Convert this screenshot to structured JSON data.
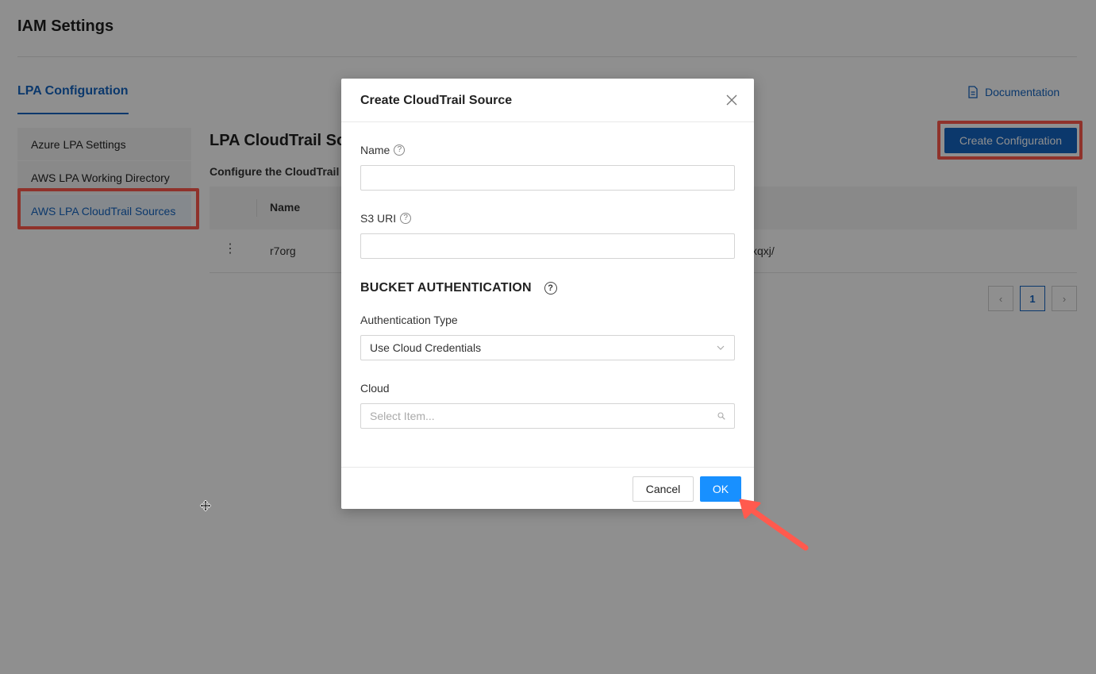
{
  "page": {
    "title": "IAM Settings",
    "tab": "LPA Configuration",
    "documentation_link": "Documentation",
    "documentation_icon": "document-icon"
  },
  "sidebar": {
    "items": [
      {
        "label": "Azure LPA Settings",
        "active": false
      },
      {
        "label": "AWS LPA Working Directory",
        "active": false
      },
      {
        "label": "AWS LPA CloudTrail Sources",
        "active": true
      }
    ]
  },
  "main": {
    "section_title": "LPA CloudTrail So",
    "section_description": "Configure the CloudTrail s",
    "create_button": "Create Configuration",
    "table": {
      "columns": [
        "Name"
      ],
      "rows": [
        {
          "menu": "⋮",
          "name": "r7org",
          "uri_fragment": "xqxj/"
        }
      ]
    },
    "pagination": {
      "prev": "‹",
      "current": "1",
      "next": "›"
    }
  },
  "modal": {
    "title": "Create CloudTrail Source",
    "close_icon": "close-icon",
    "fields": {
      "name_label": "Name",
      "name_value": "",
      "s3_label": "S3 URI",
      "s3_value": ""
    },
    "bucket_section": "BUCKET AUTHENTICATION",
    "auth_type_label": "Authentication Type",
    "auth_type_value": "Use Cloud Credentials",
    "cloud_label": "Cloud",
    "cloud_placeholder": "Select Item...",
    "cancel_button": "Cancel",
    "ok_button": "OK",
    "help_icon_text": "?"
  },
  "annotations": {
    "highlight_color": "#ff5a4e"
  },
  "colors": {
    "primary": "#1565c0",
    "ok_button": "#1890ff"
  }
}
